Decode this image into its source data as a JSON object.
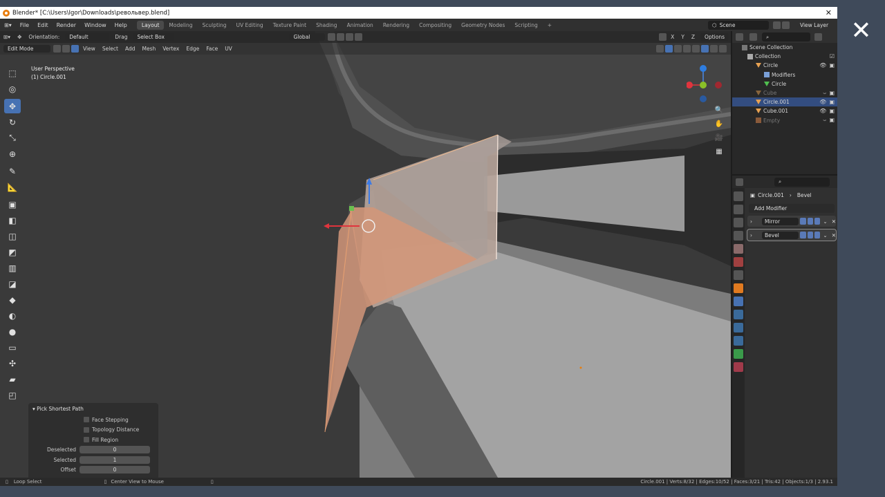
{
  "window": {
    "title": "Blender* [C:\\Users\\Igor\\Downloads\\револьвер.blend]",
    "close_glyph": "✕"
  },
  "menu": [
    "File",
    "Edit",
    "Render",
    "Window",
    "Help"
  ],
  "workspaces": {
    "tabs": [
      "Layout",
      "Modeling",
      "Sculpting",
      "UV Editing",
      "Texture Paint",
      "Shading",
      "Animation",
      "Rendering",
      "Compositing",
      "Geometry Nodes",
      "Scripting"
    ],
    "active": "Layout",
    "add": "+"
  },
  "scene": {
    "name": "Scene",
    "view_layer": "View Layer"
  },
  "viewport_header": {
    "orientation_label": "Orientation:",
    "orientation_value": "Default",
    "drag_label": "Drag",
    "drag_value": "Select Box",
    "transform_orientation": "Global",
    "options": "Options",
    "axes": [
      "X",
      "Y",
      "Z"
    ]
  },
  "edit_header": {
    "mode": "Edit Mode",
    "menus": [
      "View",
      "Select",
      "Add",
      "Mesh",
      "Vertex",
      "Edge",
      "Face",
      "UV"
    ]
  },
  "viewport_overlay": {
    "line1": "User Perspective",
    "line2": "(1) Circle.001"
  },
  "operator_panel": {
    "title": "Pick Shortest Path",
    "checks": [
      "Face Stepping",
      "Topology Distance",
      "Fill Region"
    ],
    "fields": [
      {
        "label": "Deselected",
        "value": "0"
      },
      {
        "label": "Selected",
        "value": "1"
      },
      {
        "label": "Offset",
        "value": "0"
      }
    ]
  },
  "outliner": {
    "root": "Scene Collection",
    "rows": [
      {
        "name": "Collection",
        "indent": 1,
        "type": "collection"
      },
      {
        "name": "Circle",
        "indent": 2,
        "type": "object"
      },
      {
        "name": "Modifiers",
        "indent": 3,
        "type": "modifiers"
      },
      {
        "name": "Circle",
        "indent": 3,
        "type": "mesh"
      },
      {
        "name": "Cube",
        "indent": 2,
        "type": "object",
        "dim": true
      },
      {
        "name": "Circle.001",
        "indent": 2,
        "type": "object",
        "selected": true
      },
      {
        "name": "Cube.001",
        "indent": 2,
        "type": "object"
      },
      {
        "name": "Empty",
        "indent": 2,
        "type": "empty",
        "dim": true
      }
    ]
  },
  "properties": {
    "object": "Circle.001",
    "modifier": "Bevel",
    "add_modifier": "Add Modifier",
    "modifiers": [
      {
        "name": "Mirror",
        "active": false
      },
      {
        "name": "Bevel",
        "active": true
      }
    ]
  },
  "statusbar": {
    "left1": "Loop Select",
    "left2": "Center View to Mouse",
    "right": "Circle.001 | Verts:8/32 | Edges:10/52 | Faces:3/21 | Tris:42 | Objects:1/3 | 2.93.1"
  },
  "colors": {
    "accent": "#4772b3",
    "selection_face": "#d2977a",
    "header_bg": "#303030"
  }
}
